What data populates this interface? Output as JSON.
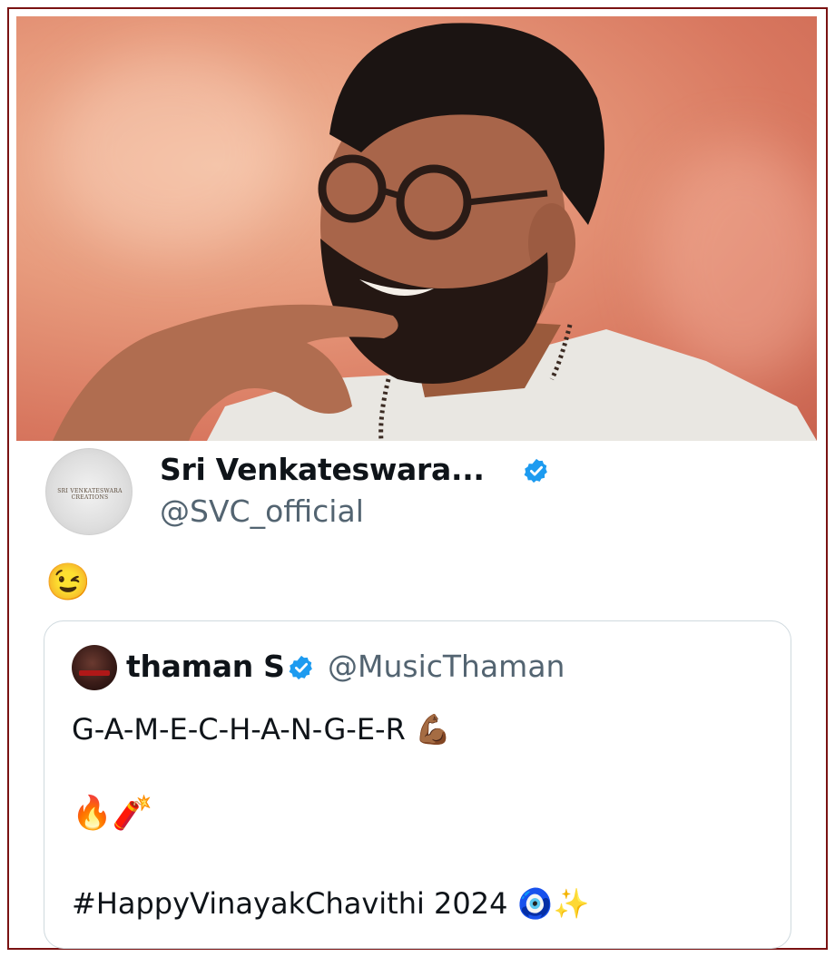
{
  "post": {
    "display_name": "Sri Venkateswara...",
    "handle": "@SVC_official",
    "avatar_text": "SRI VENKATESWARA CREATIONS",
    "text": "😉"
  },
  "quoted_post": {
    "display_name": "thaman S",
    "handle": "@MusicThaman",
    "line1": "G-A-M-E-C-H-A-N-G-E-R 💪🏾",
    "line2": "🔥🧨",
    "line3": "#HappyVinayakChavithi 2024 🧿✨"
  },
  "colors": {
    "verified": "#1d9bf0",
    "handle": "#536471",
    "border": "#7a1212"
  },
  "icons": {
    "verified": "verified-badge-icon"
  }
}
